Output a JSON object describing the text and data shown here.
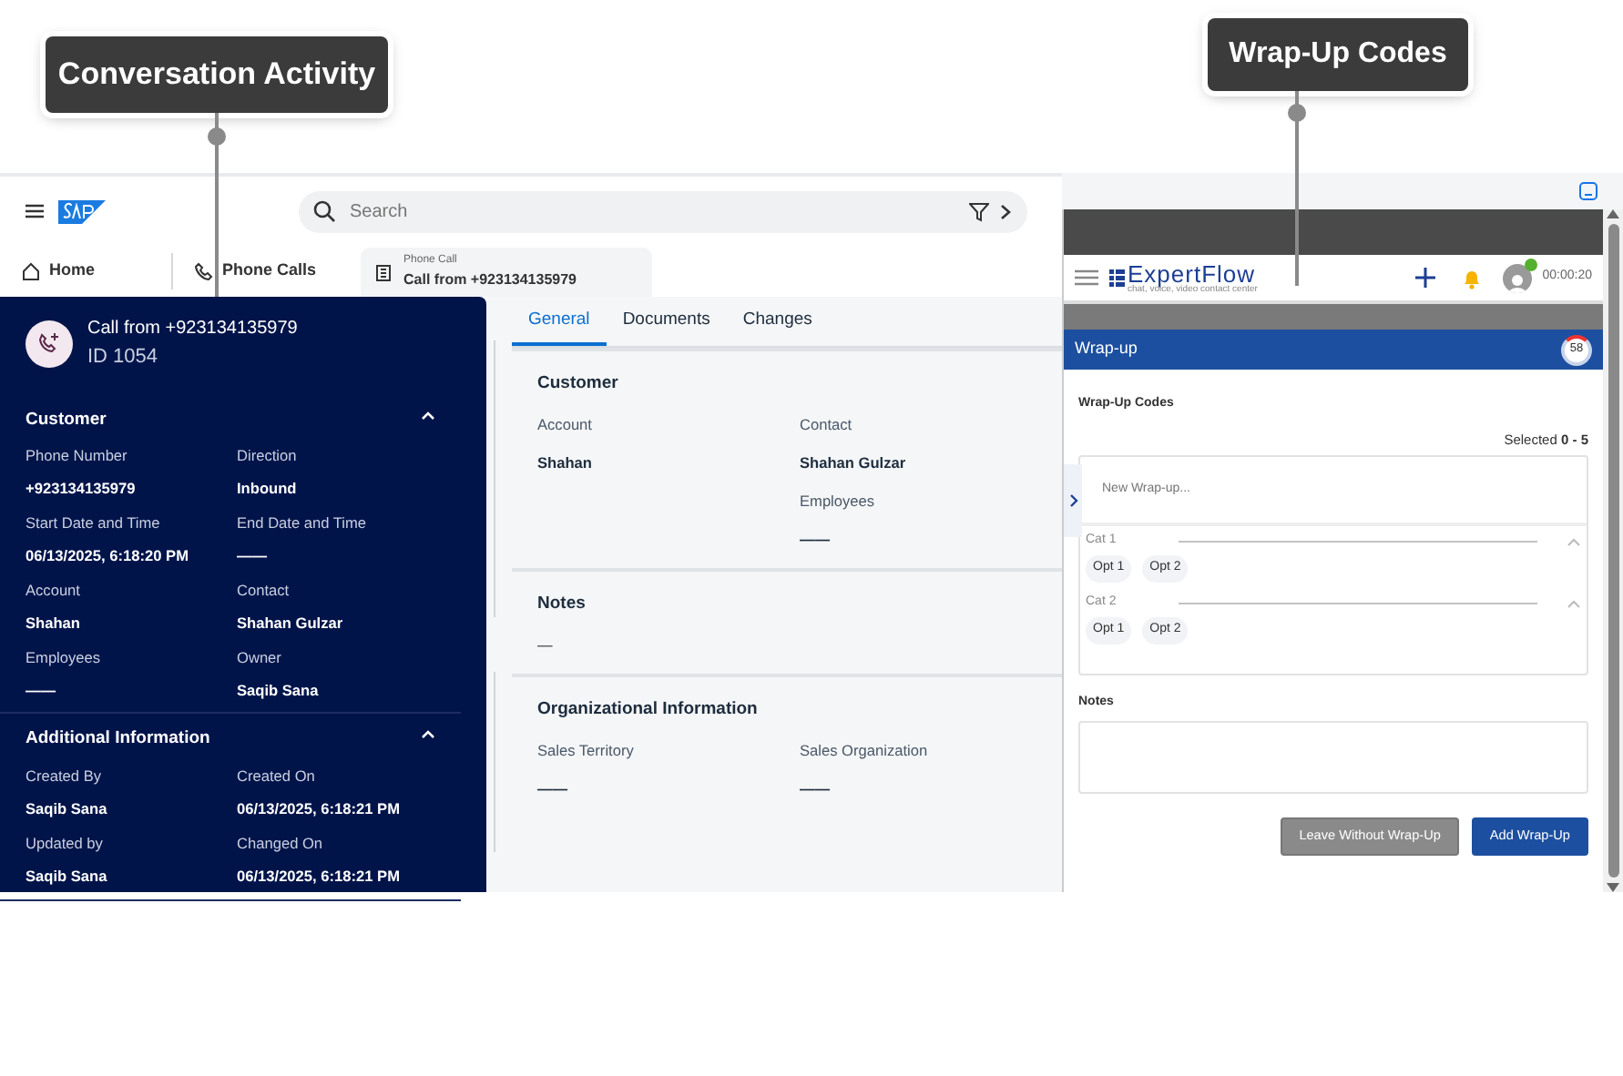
{
  "callouts": [
    {
      "label": "Conversation Activity",
      "kind": "left"
    },
    {
      "label": "Wrap-Up Codes",
      "kind": "right"
    }
  ],
  "sap": {
    "search": {
      "placeholder": "Search"
    },
    "nav": [
      {
        "label": "Home",
        "kind": "home"
      },
      {
        "label": "Phone Calls",
        "kind": "phone"
      }
    ],
    "open_tab": {
      "type": "Phone Call",
      "title": "Call from +923134135979"
    }
  },
  "activity": {
    "title": "Call from +923134135979",
    "id": "ID 1054",
    "sections": [
      {
        "title": "Customer",
        "expanded": true,
        "fields": [
          {
            "label": "Phone Number",
            "value": "+923134135979"
          },
          {
            "label": "Direction",
            "value": "Inbound"
          },
          {
            "label": "Start Date and Time",
            "value": "06/13/2025, 6:18:20 PM"
          },
          {
            "label": "End Date and Time",
            "value": "——"
          },
          {
            "label": "Account",
            "value": "Shahan"
          },
          {
            "label": "Contact",
            "value": "Shahan Gulzar"
          },
          {
            "label": "Employees",
            "value": "——"
          },
          {
            "label": "Owner",
            "value": "Saqib Sana"
          }
        ]
      },
      {
        "title": "Additional Information",
        "expanded": true,
        "fields": [
          {
            "label": "Created By",
            "value": "Saqib Sana"
          },
          {
            "label": "Created On",
            "value": "06/13/2025, 6:18:21 PM"
          },
          {
            "label": "Updated by",
            "value": "Saqib Sana"
          },
          {
            "label": "Changed On",
            "value": "06/13/2025, 6:18:21 PM"
          }
        ]
      }
    ]
  },
  "detail": {
    "tabs": [
      {
        "label": "General",
        "selected": true
      },
      {
        "label": "Documents",
        "selected": false
      },
      {
        "label": "Changes",
        "selected": false
      }
    ],
    "sections": [
      {
        "title": "Customer",
        "fields": [
          {
            "kind": "field",
            "label": "Account",
            "value": "Shahan"
          },
          {
            "kind": "field",
            "label": "Contact",
            "value": "Shahan Gulzar"
          },
          {
            "kind": "gap"
          },
          {
            "kind": "field",
            "label": "Employees",
            "value": "——"
          }
        ]
      },
      {
        "title": "Notes",
        "fields": [
          {
            "kind": "note",
            "value": "—"
          }
        ]
      },
      {
        "title": "Organizational Information",
        "fields": [
          {
            "kind": "field",
            "label": "Sales Territory",
            "value": "——"
          },
          {
            "kind": "field",
            "label": "Sales Organization",
            "value": "——"
          }
        ]
      }
    ]
  },
  "expertflow": {
    "brand": "ExpertFlow",
    "tagline": "chat, voice, video contact center",
    "online": true,
    "time": "00:00:20",
    "wrapup": {
      "title": "Wrap-up",
      "timer": "58",
      "codes_label": "Wrap-Up Codes",
      "selected": "Selected **0 - 5**",
      "search": {
        "placeholder": "New Wrap-up..."
      },
      "categories": [
        {
          "name": "Cat 1",
          "expanded": true,
          "options": [
            {
              "label": "Opt 1",
              "selected": false
            },
            {
              "label": "Opt 2",
              "selected": false
            }
          ]
        },
        {
          "name": "Cat 2",
          "expanded": true,
          "options": [
            {
              "label": "Opt 1",
              "selected": false
            },
            {
              "label": "Opt 2",
              "selected": false
            }
          ]
        }
      ],
      "notes_label": "Notes",
      "buttons": [
        {
          "label": "Leave Without Wrap-Up",
          "kind": "secondary"
        },
        {
          "label": "Add Wrap-Up",
          "kind": "primary"
        }
      ]
    }
  }
}
